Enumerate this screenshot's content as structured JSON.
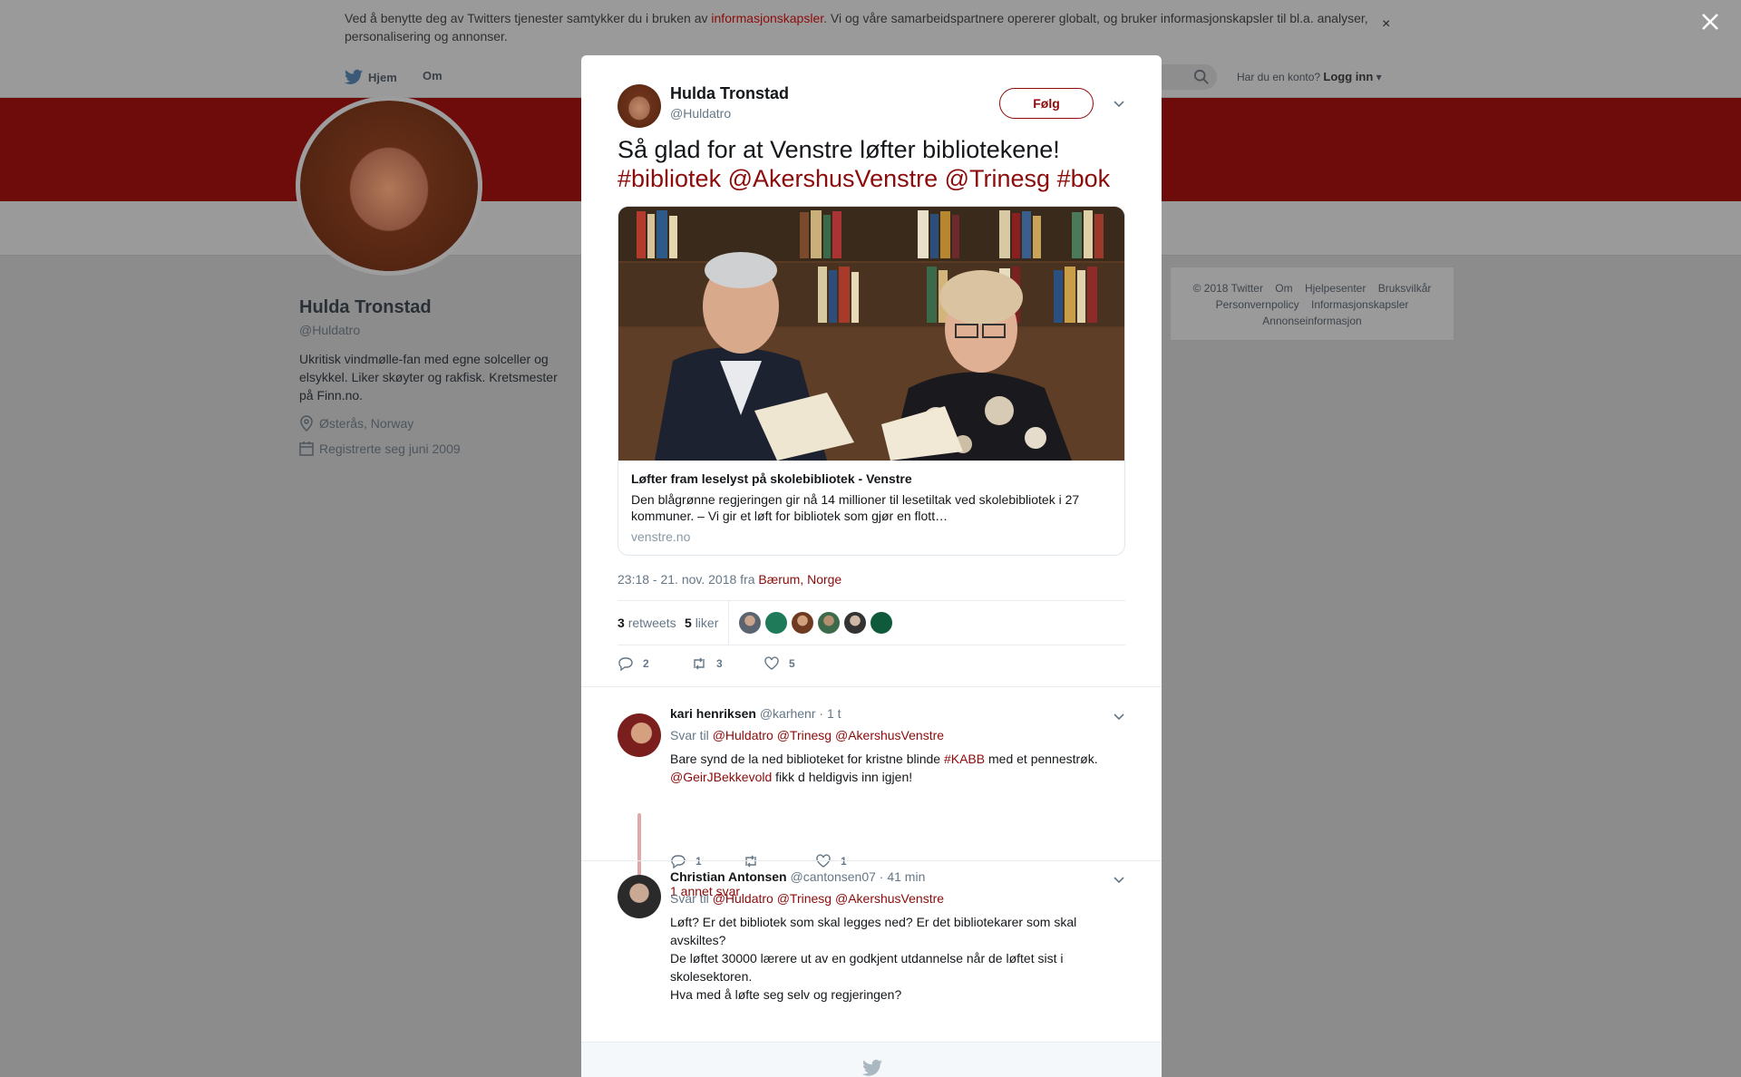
{
  "cookie": {
    "text_before": "Ved å benytte deg av Twitters tjenester samtykker du i bruken av ",
    "link": "informasjonskapsler",
    "text_after": ". Vi og våre samarbeidspartnere opererer globalt, og bruker informasjonskapsler til bl.a. analyser, personalisering og annonser.",
    "close": "×"
  },
  "nav": {
    "home": "Hjem",
    "about": "Om",
    "account_prompt": "Har du en konto?",
    "login": "Logg inn"
  },
  "profile": {
    "name": "Hulda Tronstad",
    "handle": "@Huldatro",
    "bio": "Ukritisk vindmølle-fan med egne solceller og elsykkel. Liker skøyter og rakfisk. Kretsmester på Finn.no.",
    "location": "Østerås, Norway",
    "joined": "Registrerte seg juni 2009"
  },
  "footer": {
    "copyright": "© 2018 Twitter",
    "about": "Om",
    "help": "Hjelpesenter",
    "terms": "Bruksvilkår",
    "privacy": "Personvernpolicy",
    "cookies": "Informasjonskapsler",
    "ads": "Annonseinformasjon"
  },
  "tweet": {
    "author_name": "Hulda Tronstad",
    "author_handle": "@Huldatro",
    "follow": "Følg",
    "text": "Så glad for at Venstre løfter bibliotekene!",
    "tags": [
      "#bibliotek",
      "@AkershusVenstre",
      "@Trinesg",
      "#bok"
    ],
    "card": {
      "title": "Løfter fram leselyst på skolebibliotek - Venstre",
      "description": "Den blågrønne regjeringen gir nå 14 millioner til lesetiltak ved skolebibliotek i 27 kommuner. – Vi gir et løft for bibliotek som gjør en flott…",
      "domain": "venstre.no"
    },
    "time": "23:18 - 21. nov. 2018 fra ",
    "place": "Bærum, Norge",
    "retweets_count": "3",
    "retweets_label": "retweets",
    "likes_count": "5",
    "likes_label": "liker",
    "actions": {
      "replies": "2",
      "retweets": "3",
      "likes": "5"
    }
  },
  "replies": [
    {
      "name": "kari henriksen",
      "handle": "@karhenr",
      "time": "· 1 t",
      "to_label": "Svar til",
      "to": [
        "@Huldatro",
        "@Trinesg",
        "@AkershusVenstre"
      ],
      "body_1": "Bare synd de la ned biblioteket for kristne blinde ",
      "body_tag": "#KABB",
      "body_2": " med et pennestrøk.",
      "body_mention": "@GeirJBekkevold",
      "body_3": " fikk d heldigvis inn igjen!",
      "actions": {
        "replies": "1",
        "retweets": "",
        "likes": "1"
      },
      "more": "1 annet svar"
    },
    {
      "name": "Christian Antonsen",
      "handle": "@cantonsen07",
      "time": "· 41 min",
      "to_label": "Svar til",
      "to": [
        "@Huldatro",
        "@Trinesg",
        "@AkershusVenstre"
      ],
      "lines": [
        "Løft? Er det bibliotek som skal legges ned? Er det bibliotekarer som skal avskiltes?",
        "De løftet 30000 lærere ut av en godkjent utdannelse når de løftet sist i skolesektoren.",
        "Hva med å løfte seg selv og regjeringen?"
      ]
    }
  ],
  "colors": {
    "accent": "#8c0b0b",
    "banner": "#6e0b0b",
    "overlay": "#8c8c8c"
  }
}
